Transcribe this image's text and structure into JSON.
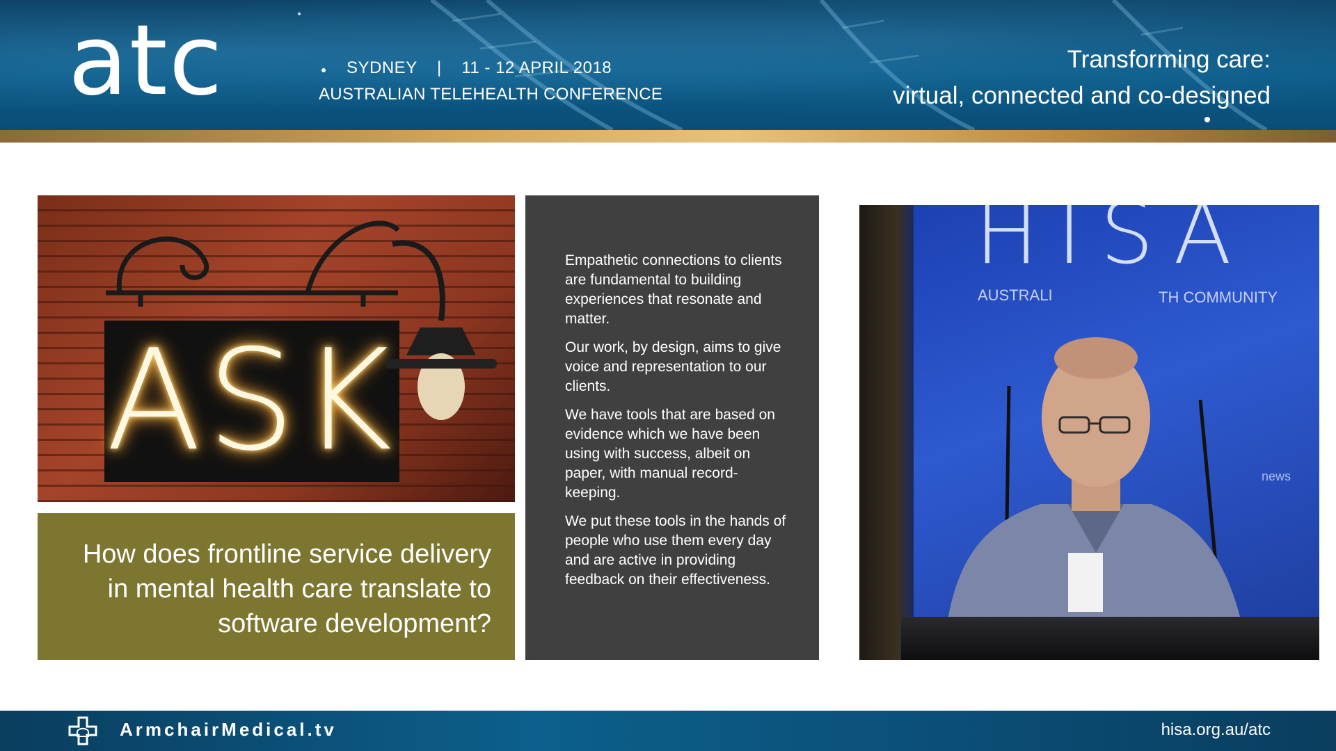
{
  "header": {
    "logo": "atc",
    "city": "SYDNEY",
    "separator": "|",
    "dates": "11 - 12 APRIL 2018",
    "conference": "AUSTRALIAN TELEHEALTH CONFERENCE",
    "tagline_line1": "Transforming care:",
    "tagline_line2": "virtual, connected and co-designed"
  },
  "slide": {
    "sign_text": "ASK",
    "question": "How does frontline service delivery in mental health care translate to software development?",
    "paragraphs": [
      "Empathetic connections to clients are fundamental to building experiences that resonate and matter.",
      "Our work, by design, aims to give voice and representation to our clients.",
      "We have tools that are based on evidence which we have been using with success, albeit on paper, with manual record-keeping.",
      "We put these tools in the hands of people who use them every day and are active in providing feedback on their effectiveness."
    ]
  },
  "video": {
    "backdrop_title": "HISA",
    "backdrop_left": "AUSTRALI",
    "backdrop_right": "TH COMMUNITY",
    "backdrop_news": "news"
  },
  "footer": {
    "brand": "ArmchairMedical.tv",
    "url": "hisa.org.au/atc"
  },
  "colors": {
    "header_blue": "#0a5a87",
    "gold": "#d2a860",
    "question_olive": "#7d7630",
    "text_panel_gray": "#404040",
    "video_blue": "#2e5ad0"
  }
}
